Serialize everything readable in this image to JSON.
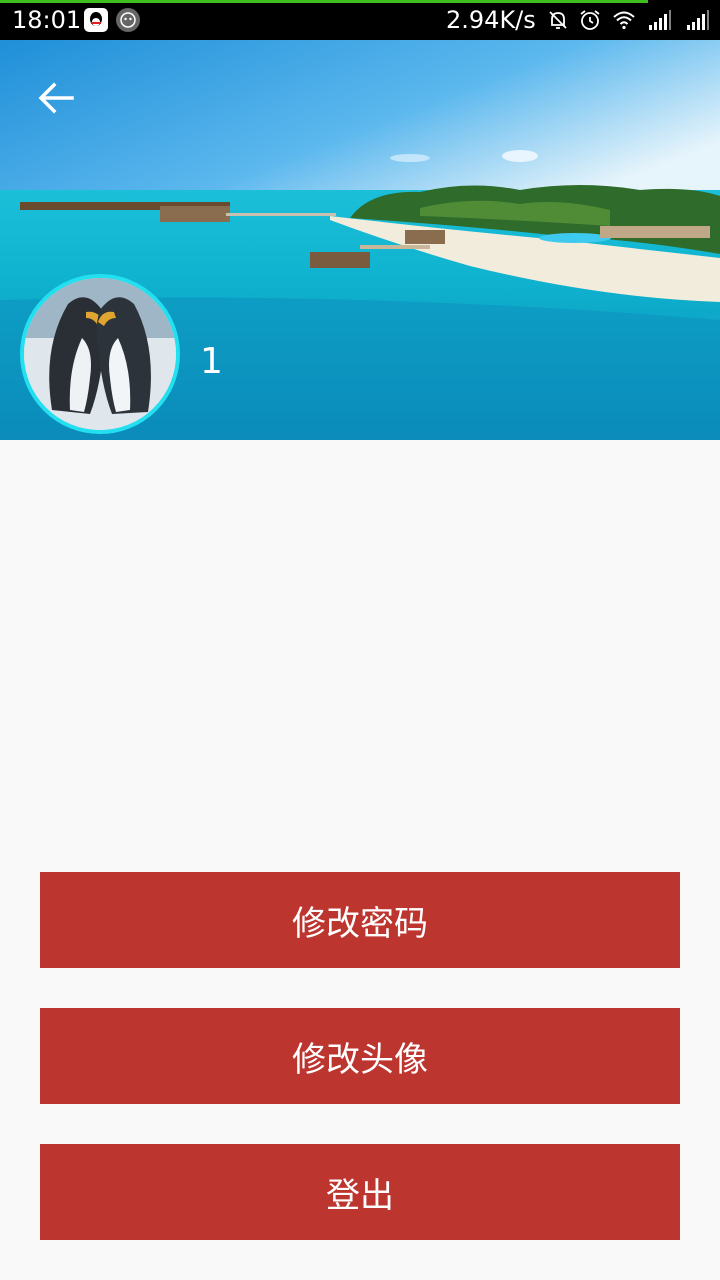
{
  "status_bar": {
    "time": "18:01",
    "network_speed": "2.94K/s",
    "load_progress_pct": 90,
    "icons": [
      "qq-icon",
      "app-badge-icon",
      "mute-bell-icon",
      "alarm-icon",
      "wifi-icon",
      "signal-icon",
      "signal-icon"
    ]
  },
  "header": {
    "back_icon": "arrow-left-icon",
    "background": "tropical-island-photo",
    "avatar": "penguins-photo",
    "username": "1"
  },
  "actions": {
    "change_password": "修改密码",
    "change_avatar": "修改头像",
    "logout": "登出"
  },
  "colors": {
    "button_bg": "#bc352f",
    "avatar_ring": "#22e0f0",
    "page_bg": "#f9f9f9"
  }
}
